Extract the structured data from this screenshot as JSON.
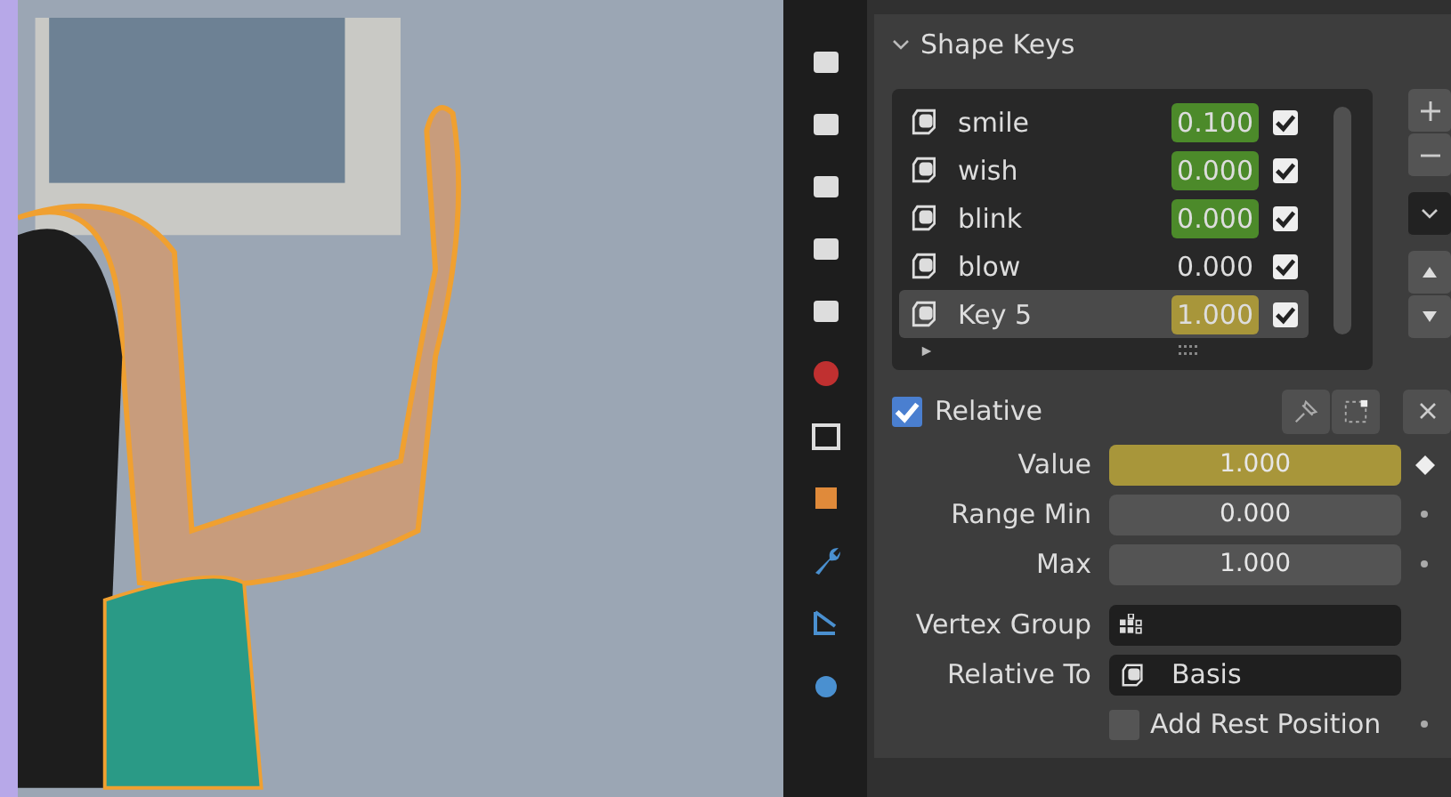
{
  "panel": {
    "title": "Shape Keys",
    "expanded": true
  },
  "shape_keys": [
    {
      "name": "smile",
      "value": "0.100",
      "animated": true,
      "on_keyframe": false,
      "enabled": true,
      "selected": false
    },
    {
      "name": "wish",
      "value": "0.000",
      "animated": true,
      "on_keyframe": false,
      "enabled": true,
      "selected": false
    },
    {
      "name": "blink",
      "value": "0.000",
      "animated": true,
      "on_keyframe": false,
      "enabled": true,
      "selected": false
    },
    {
      "name": "blow",
      "value": "0.000",
      "animated": false,
      "enabled": true,
      "selected": false
    },
    {
      "name": "Key 5",
      "value": "1.000",
      "animated": true,
      "on_keyframe": true,
      "enabled": true,
      "selected": true
    }
  ],
  "relative": {
    "label": "Relative",
    "checked": true
  },
  "fields": [
    {
      "kind": "slider",
      "label": "Value",
      "value": "1.000",
      "level": 1,
      "animated": true,
      "on_keyframe": true
    },
    {
      "kind": "number",
      "label": "Range Min",
      "value": "0.000",
      "animated": false
    },
    {
      "kind": "number",
      "label": "Max",
      "value": "1.000",
      "animated": false
    },
    {
      "kind": "vgroup",
      "label": "Vertex Group"
    },
    {
      "kind": "key",
      "label": "Relative To",
      "value": "Basis"
    }
  ],
  "rest_position": {
    "label": "Add Rest Position",
    "checked": false
  }
}
